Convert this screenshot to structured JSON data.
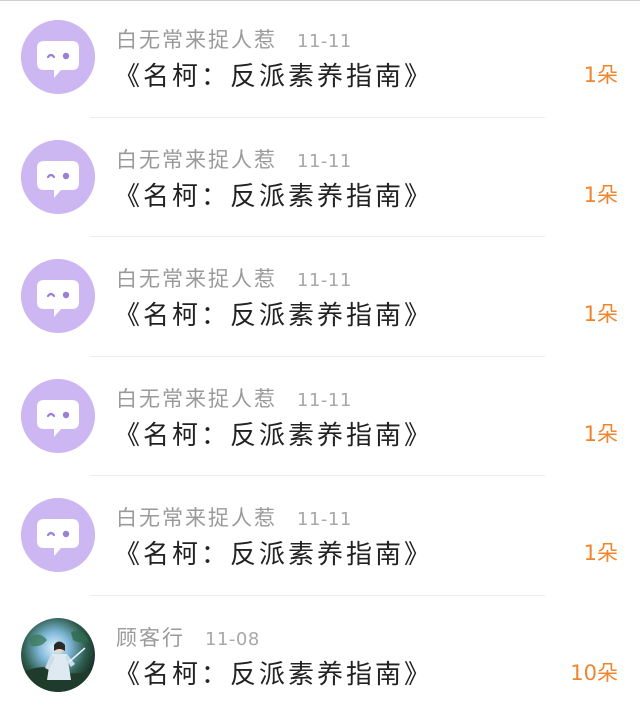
{
  "colors": {
    "avatar_bg": "#cdb7f3",
    "name_text": "#9a9a9a",
    "title_text": "#222222",
    "count_text": "#f0852f"
  },
  "rows": [
    {
      "name": "白无常来捉人惹",
      "date": "11-11",
      "title": "《名柯：反派素养指南》",
      "count": "1朵",
      "avatar": "chat-bubble-icon"
    },
    {
      "name": "白无常来捉人惹",
      "date": "11-11",
      "title": "《名柯：反派素养指南》",
      "count": "1朵",
      "avatar": "chat-bubble-icon"
    },
    {
      "name": "白无常来捉人惹",
      "date": "11-11",
      "title": "《名柯：反派素养指南》",
      "count": "1朵",
      "avatar": "chat-bubble-icon"
    },
    {
      "name": "白无常来捉人惹",
      "date": "11-11",
      "title": "《名柯：反派素养指南》",
      "count": "1朵",
      "avatar": "chat-bubble-icon"
    },
    {
      "name": "白无常来捉人惹",
      "date": "11-11",
      "title": "《名柯：反派素养指南》",
      "count": "1朵",
      "avatar": "chat-bubble-icon"
    },
    {
      "name": "顾客行",
      "date": "11-08",
      "title": "《名柯：反派素养指南》",
      "count": "10朵",
      "avatar": "user-photo"
    }
  ]
}
